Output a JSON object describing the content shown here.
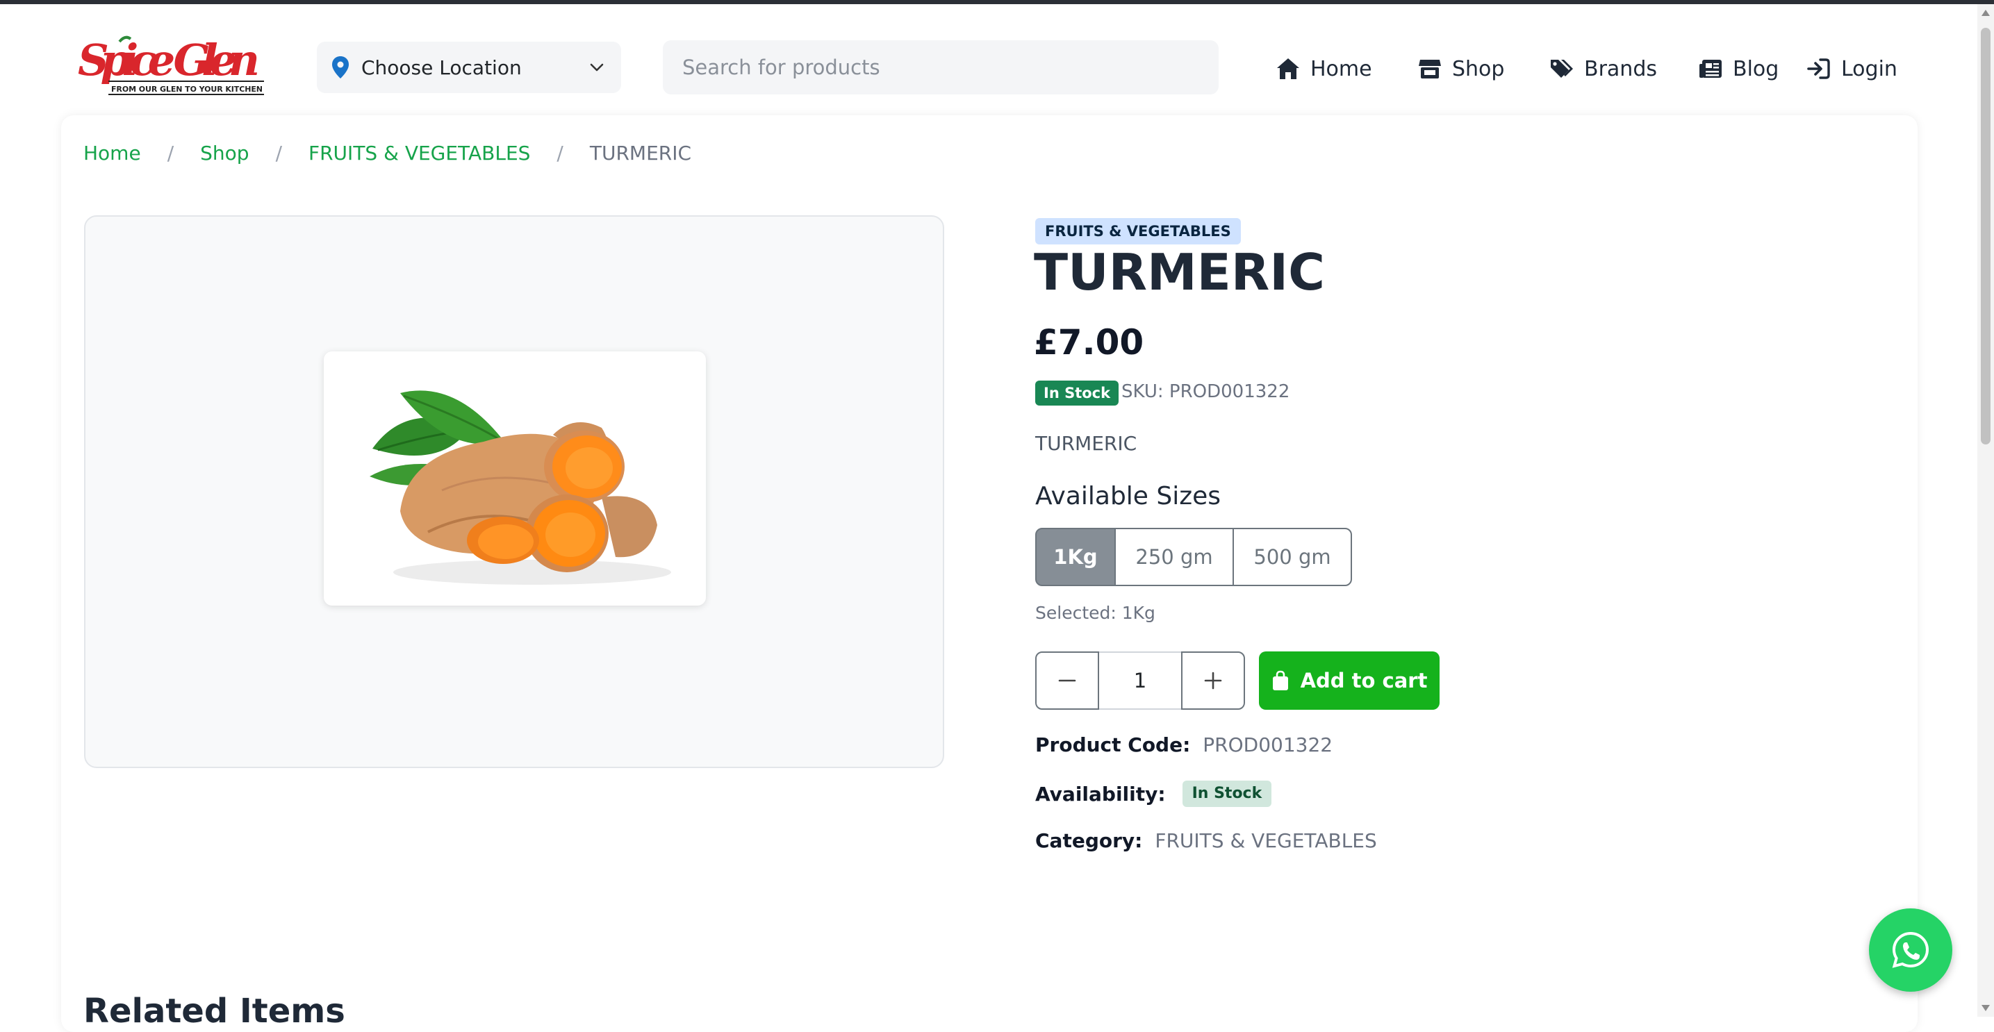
{
  "header": {
    "logo_text": "Spice Glen",
    "logo_tagline": "FROM OUR GLEN TO YOUR KITCHEN",
    "location_label": "Choose Location",
    "search_placeholder": "Search for products",
    "nav": [
      {
        "label": "Home",
        "icon": "home-icon"
      },
      {
        "label": "Shop",
        "icon": "store-icon"
      },
      {
        "label": "Brands",
        "icon": "tags-icon"
      },
      {
        "label": "Blog",
        "icon": "newspaper-icon"
      },
      {
        "label": "Login",
        "icon": "sign-in-icon"
      }
    ]
  },
  "breadcrumb": {
    "items": [
      "Home",
      "Shop",
      "FRUITS & VEGETABLES"
    ],
    "current": "TURMERIC",
    "separator": "/"
  },
  "product": {
    "category_badge": "FRUITS & VEGETABLES",
    "title": "TURMERIC",
    "price": "£7.00",
    "stock_label": "In Stock",
    "sku": "SKU: PROD001322",
    "short_description": "TURMERIC",
    "sizes_heading": "Available Sizes",
    "sizes": [
      "1Kg",
      "250 gm",
      "500 gm"
    ],
    "selected_size_index": 0,
    "selected_text": "Selected: 1Kg",
    "quantity": "1",
    "add_to_cart_label": "Add to cart",
    "code_label": "Product Code:",
    "code_value": "PROD001322",
    "availability_label": "Availability:",
    "availability_value": "In Stock",
    "category_label": "Category:",
    "category_value": "FRUITS & VEGETABLES"
  },
  "related_heading": "Related Items",
  "colors": {
    "link_green": "#16a34a",
    "cart_green": "#15b21c",
    "stock_green": "#198754",
    "whatsapp_green": "#25d366",
    "badge_blue": "#cfe2ff",
    "logo_red": "#d9262c"
  }
}
